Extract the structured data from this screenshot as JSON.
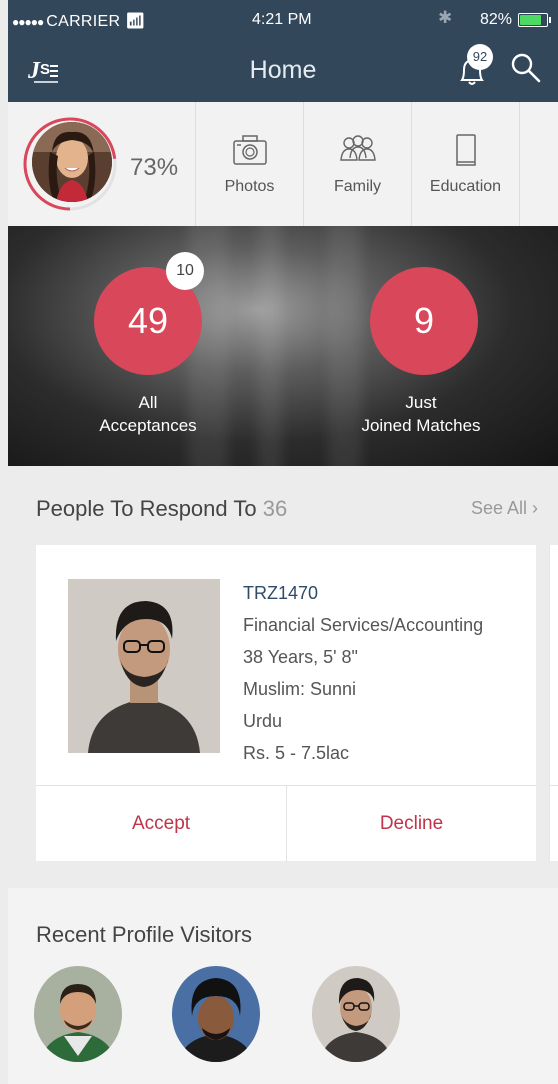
{
  "status_bar": {
    "dots": "●●●●●",
    "carrier": "CARRIER",
    "time": "4:21 PM",
    "battery": "82%",
    "battery_level": 0.82
  },
  "nav": {
    "title": "Home",
    "notification_count": "92"
  },
  "profile": {
    "completion": "73%",
    "completion_value": 0.73,
    "items": [
      {
        "label": "Photos",
        "icon": "camera-icon"
      },
      {
        "label": "Family",
        "icon": "family-icon"
      },
      {
        "label": "Education",
        "icon": "book-icon"
      }
    ]
  },
  "stats": {
    "acceptances": {
      "count": "49",
      "badge": "10",
      "line1": "All",
      "line2": "Acceptances"
    },
    "just_joined": {
      "count": "9",
      "line1": "Just",
      "line2": "Joined Matches"
    }
  },
  "people_to_respond": {
    "heading": "People To Respond To",
    "count": "36",
    "see_all": "See All ›",
    "card": {
      "id": "TRZ1470",
      "profession": "Financial Services/Accounting",
      "age_height": "38 Years, 5' 8\"",
      "religion": "Muslim: Sunni",
      "language": "Urdu",
      "income": "Rs. 5 - 7.5lac",
      "accept_label": "Accept",
      "decline_label": "Decline"
    }
  },
  "recent_visitors": {
    "heading": "Recent Profile Visitors"
  },
  "colors": {
    "header": "#33475b",
    "accent": "#d9475b",
    "action": "#c2334a"
  }
}
